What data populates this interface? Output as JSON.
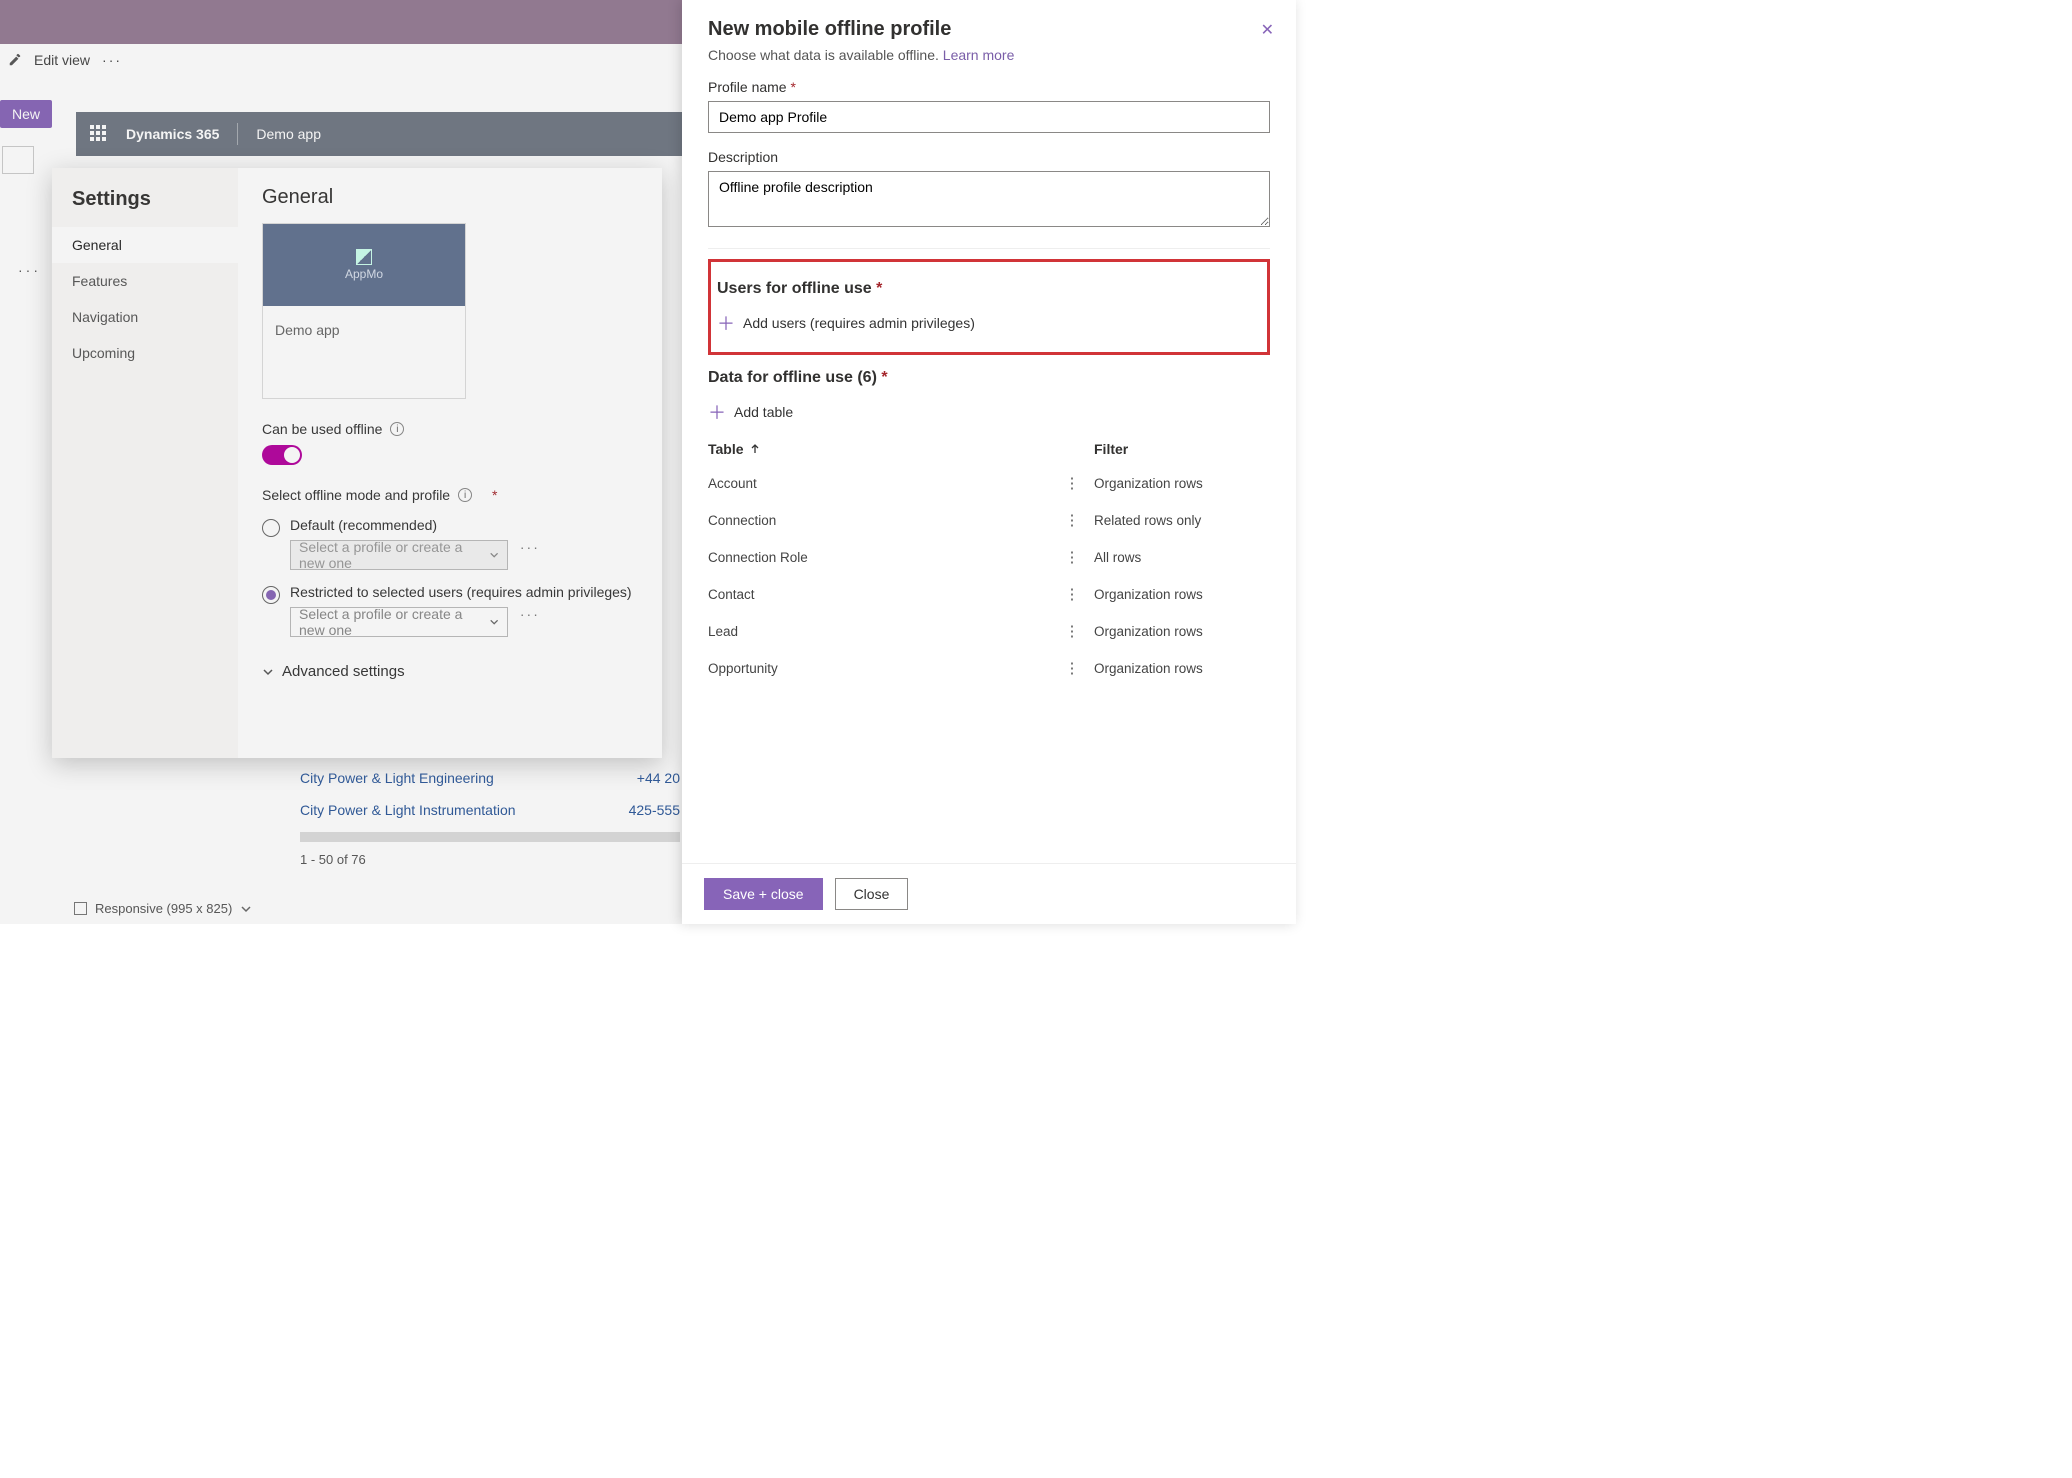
{
  "ribbon": {},
  "editbar": {
    "label": "Edit view"
  },
  "newbtn": {
    "label": "New"
  },
  "apphdr": {
    "product": "Dynamics 365",
    "appname": "Demo app"
  },
  "settings": {
    "title": "Settings",
    "items": [
      {
        "label": "General",
        "active": true
      },
      {
        "label": "Features"
      },
      {
        "label": "Navigation"
      },
      {
        "label": "Upcoming"
      }
    ],
    "general": {
      "heading": "General",
      "tile_caption": "AppMo",
      "tile_name": "Demo app",
      "offline_label": "Can be used offline",
      "mode_label": "Select offline mode and profile",
      "opt_default": "Default (recommended)",
      "opt_restricted": "Restricted to selected users (requires admin privileges)",
      "select_placeholder": "Select a profile or create a new one",
      "advanced": "Advanced settings"
    }
  },
  "bglist": {
    "rows": [
      {
        "name": "City Power & Light Engineering",
        "phone": "+44 20"
      },
      {
        "name": "City Power & Light Instrumentation",
        "phone": "425-555"
      }
    ],
    "pager": "1 - 50 of 76"
  },
  "responsive": {
    "label": "Responsive (995 x 825)"
  },
  "panel": {
    "title": "New mobile offline profile",
    "subtitle": "Choose what data is available offline.",
    "learn": "Learn more",
    "profile_name_label": "Profile name",
    "profile_name_value": "Demo app Profile",
    "description_label": "Description",
    "description_value": "Offline profile description",
    "users_heading": "Users for offline use",
    "add_users": "Add users (requires admin privileges)",
    "data_heading": "Data for offline use (6)",
    "add_table": "Add table",
    "col_table": "Table",
    "col_filter": "Filter",
    "rows": [
      {
        "name": "Account",
        "filter": "Organization rows"
      },
      {
        "name": "Connection",
        "filter": "Related rows only"
      },
      {
        "name": "Connection Role",
        "filter": "All rows"
      },
      {
        "name": "Contact",
        "filter": "Organization rows"
      },
      {
        "name": "Lead",
        "filter": "Organization rows"
      },
      {
        "name": "Opportunity",
        "filter": "Organization rows"
      }
    ],
    "save": "Save + close",
    "close": "Close"
  }
}
